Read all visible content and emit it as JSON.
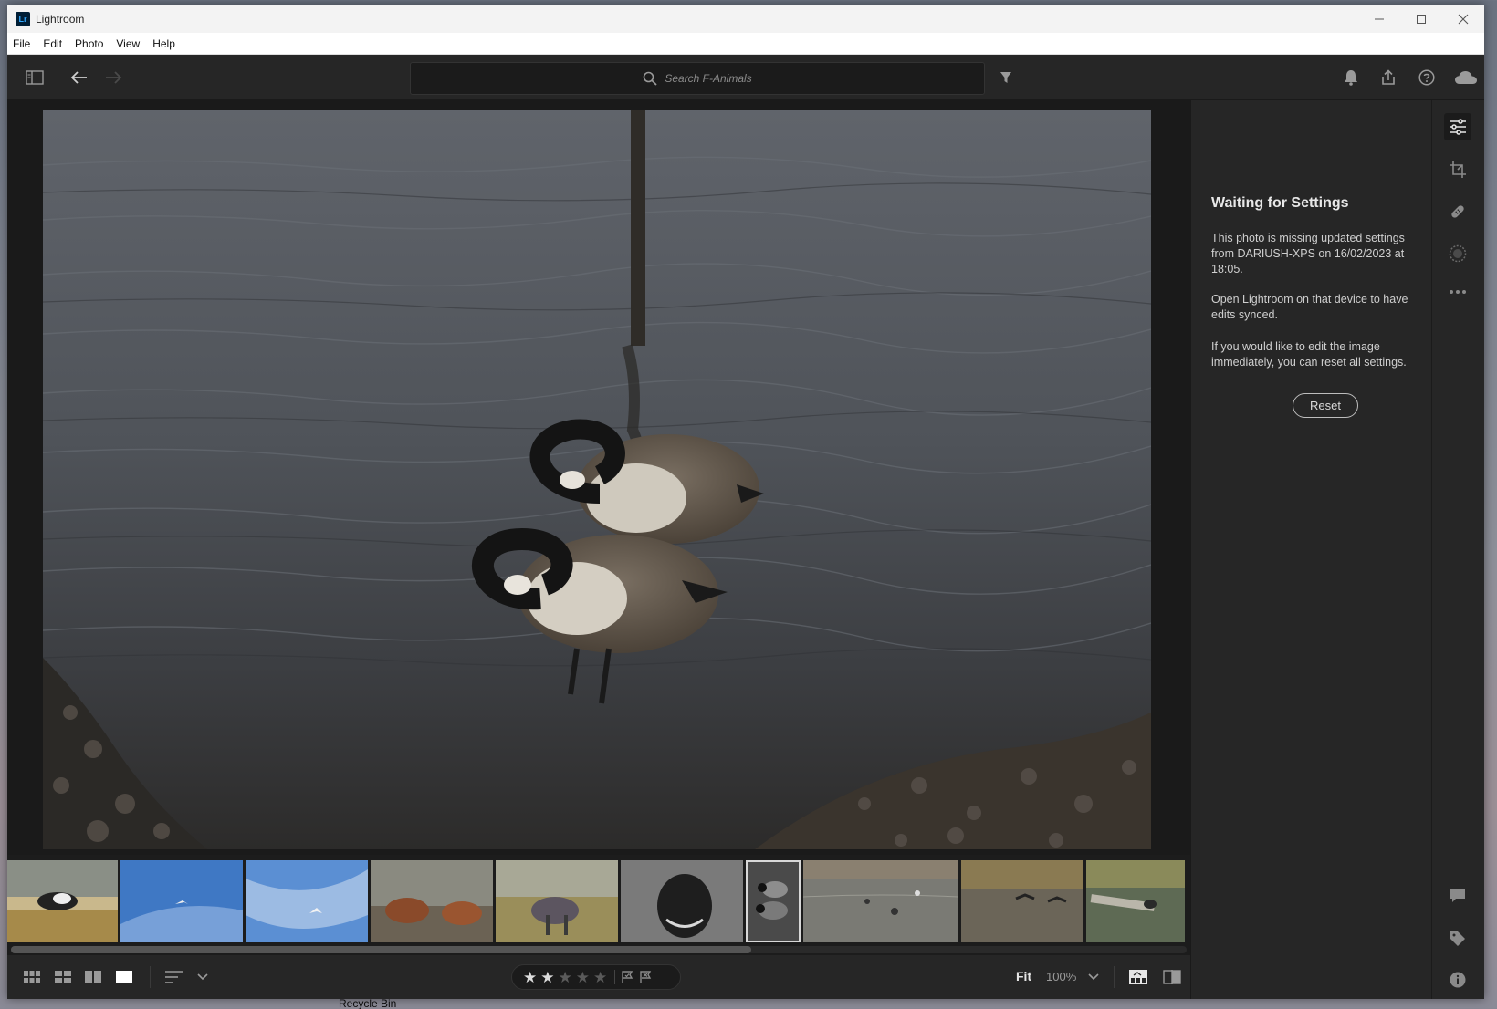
{
  "window": {
    "title": "Lightroom",
    "logo_text": "Lr",
    "controls": [
      "minimize-icon",
      "maximize-icon",
      "close-icon"
    ]
  },
  "menubar": {
    "items": [
      "File",
      "Edit",
      "Photo",
      "View",
      "Help"
    ]
  },
  "toolbar": {
    "search_placeholder": "Search F-Animals",
    "icons": [
      "panel-toggle-icon",
      "back-arrow-icon",
      "forward-arrow-icon",
      "filter-icon",
      "bell-icon",
      "share-icon",
      "help-icon",
      "cloud-icon"
    ]
  },
  "viewer": {
    "photo_subject": "two-geese-in-water"
  },
  "filmstrip": {
    "thumbnails": [
      {
        "name": "thumb-dog-beach",
        "selected": false
      },
      {
        "name": "thumb-seagull-sky-1",
        "selected": false
      },
      {
        "name": "thumb-seagull-sky-2",
        "selected": false
      },
      {
        "name": "thumb-ponies",
        "selected": false
      },
      {
        "name": "thumb-pony-rug",
        "selected": false
      },
      {
        "name": "thumb-pony-bw",
        "selected": false
      },
      {
        "name": "thumb-geese-selected",
        "selected": true
      },
      {
        "name": "thumb-geese-lake",
        "selected": false
      },
      {
        "name": "thumb-geese-flying",
        "selected": false
      },
      {
        "name": "thumb-bird-log",
        "selected": false
      }
    ],
    "scroll_fraction": 0.63
  },
  "bottombar": {
    "rating": 2,
    "max_rating": 5,
    "zoom_fit": "Fit",
    "zoom_percent": "100%",
    "icons": [
      "grid-small-icon",
      "grid-large-icon",
      "compare-icon",
      "single-view-icon",
      "sort-icon",
      "chevron-down-icon",
      "flag-pick-icon",
      "flag-reject-icon",
      "filmstrip-toggle-icon",
      "before-after-icon"
    ]
  },
  "rightpanel": {
    "title": "Waiting for Settings",
    "para1": "This photo is missing updated settings from DARIUSH-XPS on 16/02/2023 at 18:05.",
    "para2": "Open Lightroom on that device to have edits synced.",
    "para3": "If you would like to edit the image immediately, you can reset all settings.",
    "reset_label": "Reset"
  },
  "iconrail": {
    "icons": [
      "edit-sliders-icon",
      "crop-icon",
      "healing-icon",
      "masking-icon",
      "more-icon",
      "comment-icon",
      "tag-icon",
      "info-icon"
    ]
  },
  "desktop": {
    "recycle_bin_label": "Recycle Bin"
  },
  "colors": {
    "panel_bg": "#262626",
    "viewer_bg": "#1a1a1a",
    "text_primary": "#e8e8e8",
    "text_secondary": "#cfcfcf",
    "brand_lr": "#31a8ff"
  }
}
